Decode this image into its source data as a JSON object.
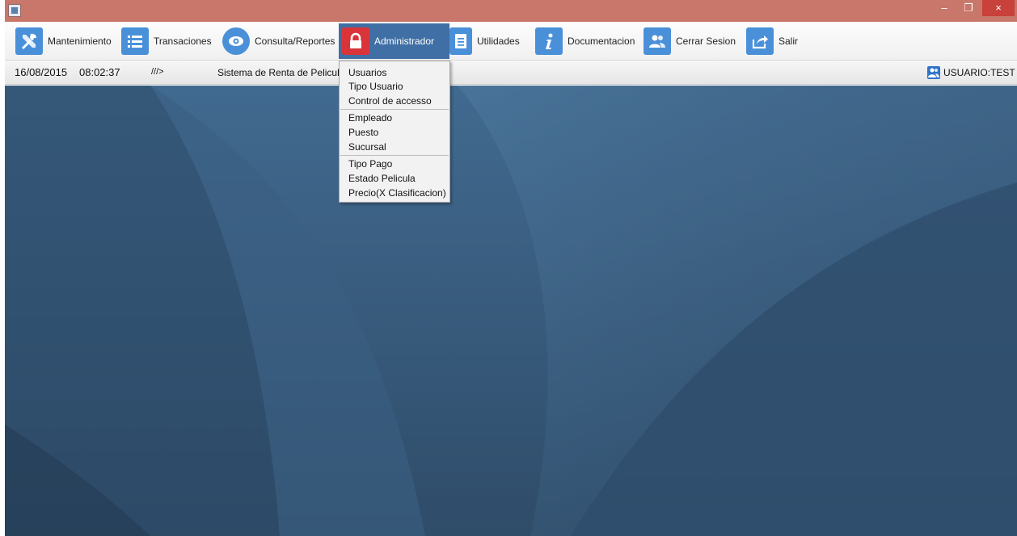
{
  "window": {
    "controls": {
      "minimize": "–",
      "maximize": "❐",
      "close": "×"
    }
  },
  "menubar": {
    "items": [
      {
        "label": "Mantenimiento",
        "icon": "tools-icon",
        "color": "#4a90d9"
      },
      {
        "label": "Transaciones",
        "icon": "list-icon",
        "color": "#4a90d9"
      },
      {
        "label": "Consulta/Reportes",
        "icon": "eye-icon",
        "color": "#4a90d9"
      },
      {
        "label": "Administrador",
        "icon": "lock-icon",
        "color": "#d9343a",
        "active": true
      },
      {
        "label": "Utilidades",
        "icon": "document-icon",
        "color": "#4a90d9"
      },
      {
        "label": "Documentacion",
        "icon": "info-icon",
        "color": "#4a90d9"
      },
      {
        "label": "Cerrar Sesion",
        "icon": "users-icon",
        "color": "#4a90d9"
      },
      {
        "label": "Salir",
        "icon": "share-exit-icon",
        "color": "#4a90d9"
      }
    ]
  },
  "statusbar": {
    "date": "16/08/2015",
    "time": "08:02:37",
    "separator": "///>",
    "system_name": "Sistema de Renta de Pelicula",
    "user": "USUARIO:TEST"
  },
  "dropdown": {
    "groups": [
      [
        "Usuarios",
        "Tipo Usuario",
        "Control de accesso"
      ],
      [
        "Empleado",
        "Puesto",
        "Sucursal"
      ],
      [
        "Tipo Pago",
        "Estado Pelicula",
        "Precio(X Clasificacion)"
      ]
    ]
  },
  "colors": {
    "titlebar": "#c9766b",
    "active_menu": "#3f6fa4",
    "desktop": "#3a5a7c",
    "icon_blue": "#4a90d9",
    "icon_red": "#d9343a"
  }
}
